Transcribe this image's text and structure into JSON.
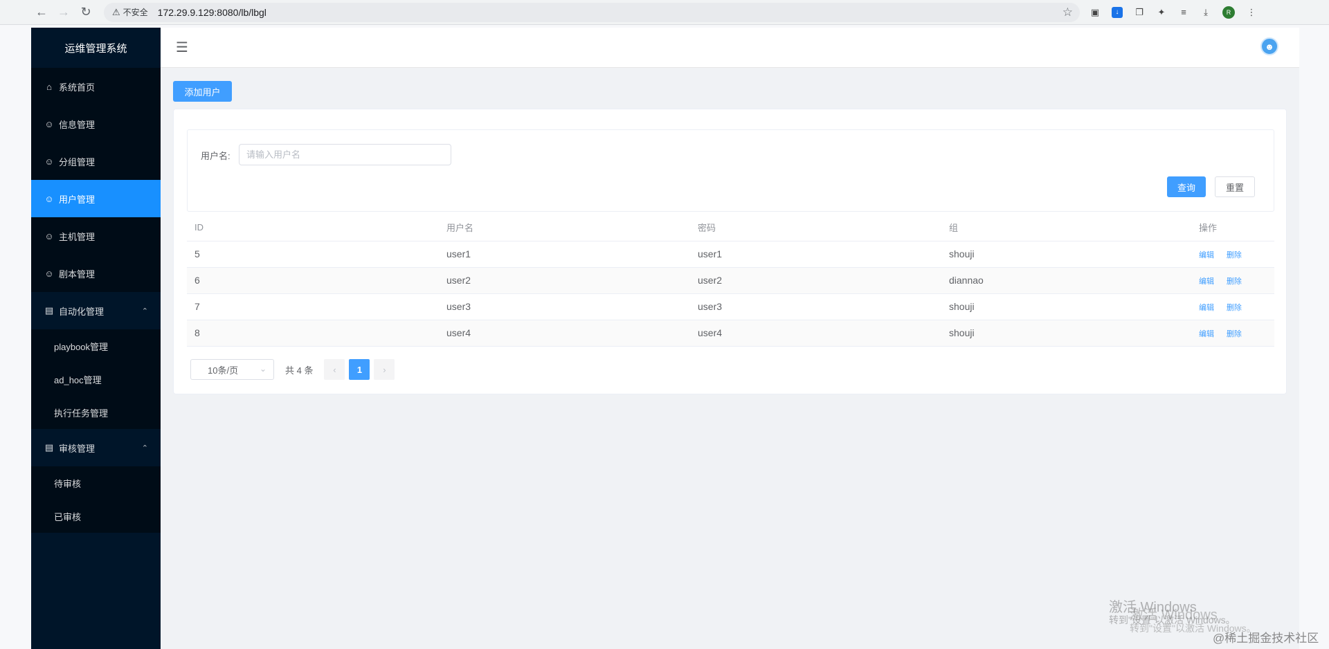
{
  "browser": {
    "security_label": "不安全",
    "url": "172.29.9.129:8080/lb/lbgl",
    "profile_initial": "R"
  },
  "sidebar": {
    "title": "运维管理系统",
    "items": [
      {
        "label": "系统首页",
        "icon": "home-icon"
      },
      {
        "label": "信息管理",
        "icon": "user-icon"
      },
      {
        "label": "分组管理",
        "icon": "user-icon"
      },
      {
        "label": "用户管理",
        "icon": "user-icon",
        "active": true
      },
      {
        "label": "主机管理",
        "icon": "user-icon"
      },
      {
        "label": "剧本管理",
        "icon": "user-icon"
      }
    ],
    "automation": {
      "label": "自动化管理",
      "children": [
        "playbook管理",
        "ad_hoc管理",
        "执行任务管理"
      ]
    },
    "review": {
      "label": "审核管理",
      "children": [
        "待审核",
        "已审核"
      ]
    }
  },
  "toolbar": {
    "add_user_label": "添加用户"
  },
  "search": {
    "label": "用户名:",
    "placeholder": "请输入用户名",
    "query_label": "查询",
    "reset_label": "重置"
  },
  "table": {
    "headers": [
      "ID",
      "用户名",
      "密码",
      "组",
      "操作"
    ],
    "rows": [
      {
        "id": "5",
        "username": "user1",
        "password": "user1",
        "group": "shouji"
      },
      {
        "id": "6",
        "username": "user2",
        "password": "user2",
        "group": "diannao"
      },
      {
        "id": "7",
        "username": "user3",
        "password": "user3",
        "group": "shouji"
      },
      {
        "id": "8",
        "username": "user4",
        "password": "user4",
        "group": "shouji"
      }
    ],
    "edit_label": "编辑",
    "delete_label": "删除"
  },
  "pagination": {
    "page_size": "10条/页",
    "total": "共 4 条",
    "current_page": "1"
  },
  "watermark": {
    "activate_title": "激活 Windows",
    "activate_hint": "转到\"设置\"以激活 Windows。",
    "site": "@稀土掘金技术社区"
  },
  "colors": {
    "sidebar_bg": "#001529",
    "active": "#1890ff",
    "primary": "#409eff"
  }
}
